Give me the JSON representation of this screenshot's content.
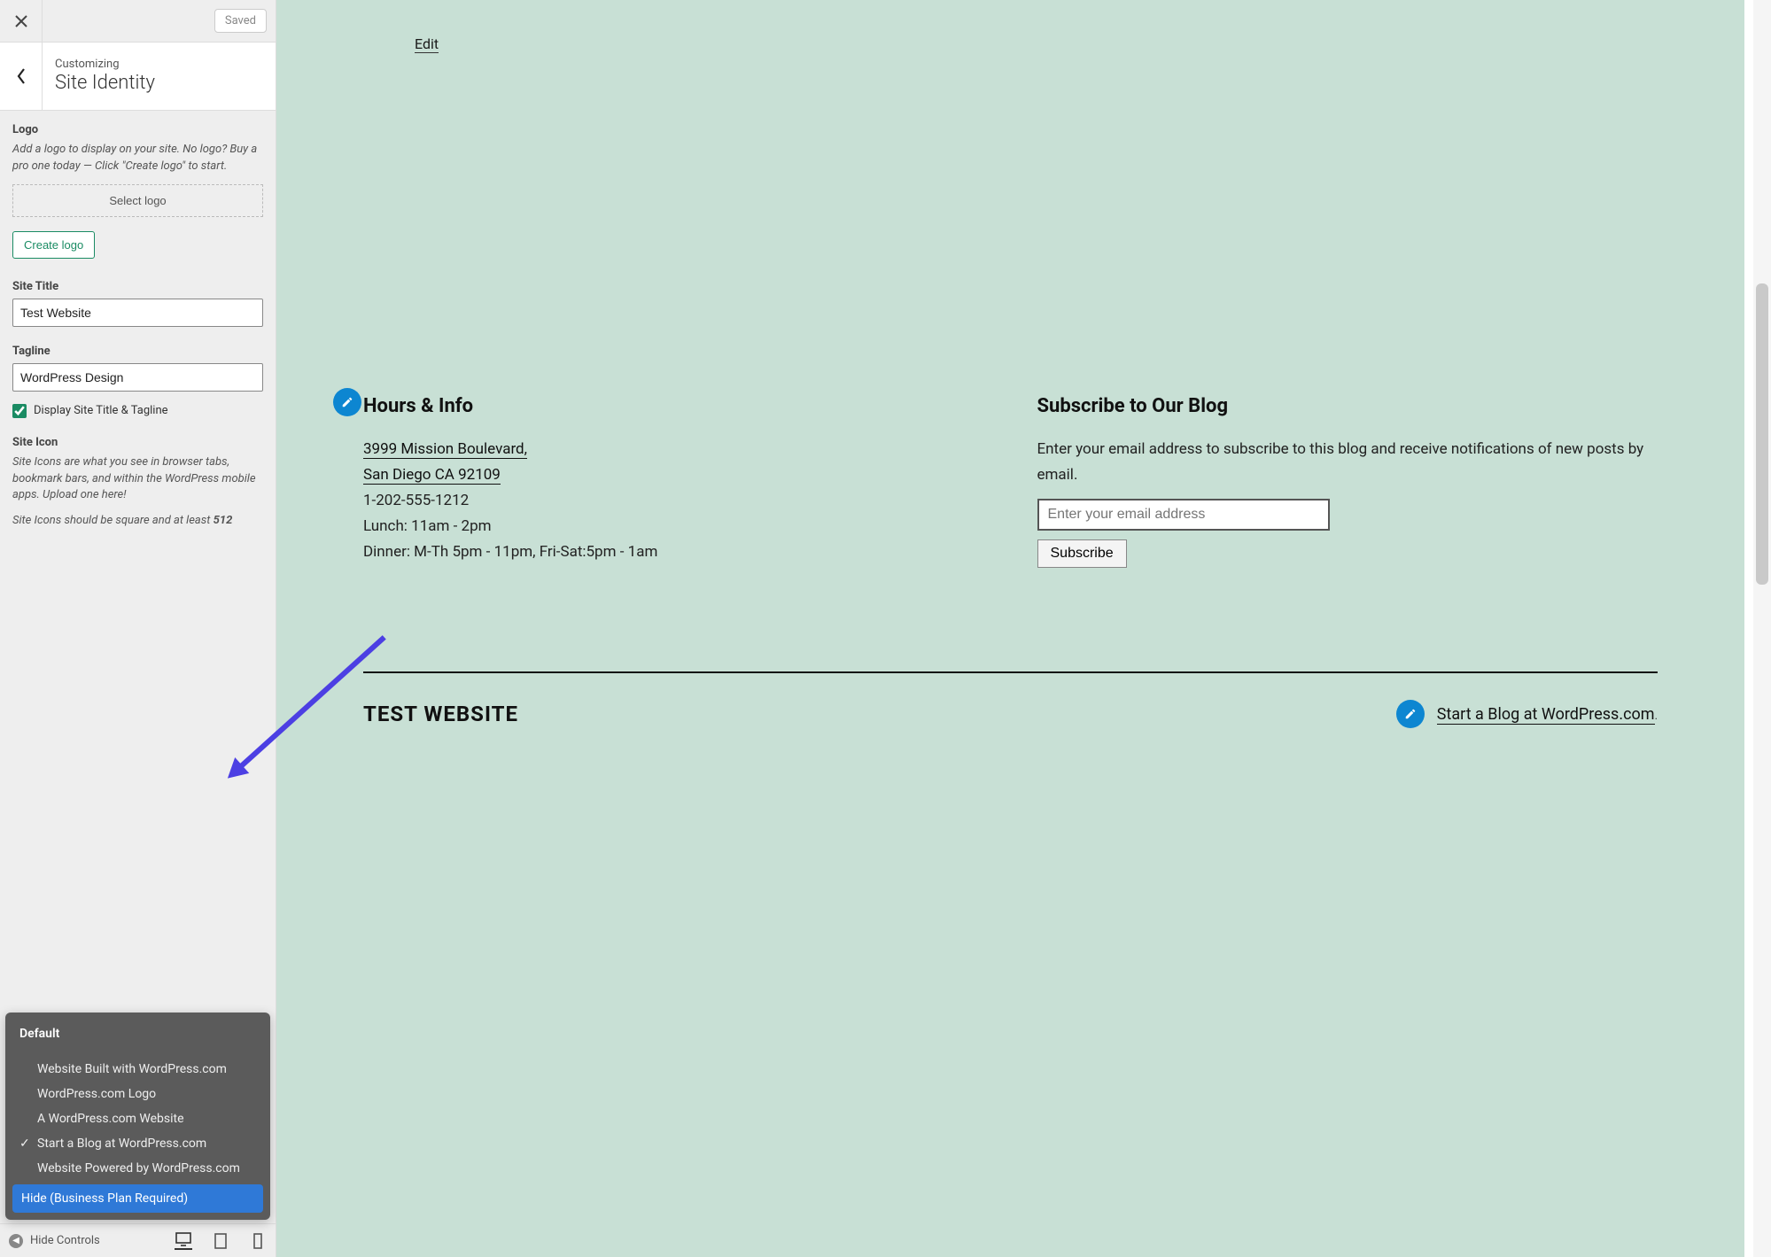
{
  "sidebar": {
    "saved_label": "Saved",
    "crumb_label": "Customizing",
    "crumb_title": "Site Identity",
    "logo": {
      "heading": "Logo",
      "help": "Add a logo to display on your site. No logo? Buy a pro one today — Click \"Create logo\" to start.",
      "select_label": "Select logo",
      "create_label": "Create logo"
    },
    "site_title": {
      "label": "Site Title",
      "value": "Test Website"
    },
    "tagline": {
      "label": "Tagline",
      "value": "WordPress Design"
    },
    "display_checkbox_label": "Display Site Title & Tagline",
    "site_icon": {
      "heading": "Site Icon",
      "help1": "Site Icons are what you see in browser tabs, bookmark bars, and within the WordPress mobile apps. Upload one here!",
      "help2_prefix": "Site Icons should be square and at least ",
      "help2_bold": "512"
    },
    "footer_dropdown": {
      "header": "Default",
      "items": [
        "Website Built with WordPress.com",
        "WordPress.com Logo",
        "A WordPress.com Website",
        "Start a Blog at WordPress.com",
        "Website Powered by WordPress.com"
      ],
      "selected_index": 3,
      "highlight": "Hide (Business Plan Required)"
    },
    "hide_controls_label": "Hide Controls"
  },
  "preview": {
    "edit_label": "Edit",
    "hours": {
      "heading": "Hours & Info",
      "addr1": "3999 Mission Boulevard,",
      "addr2": "San Diego CA 92109",
      "phone": "1-202-555-1212",
      "lunch": "Lunch: 11am - 2pm",
      "dinner": "Dinner: M-Th 5pm - 11pm, Fri-Sat:5pm - 1am"
    },
    "subscribe": {
      "heading": "Subscribe to Our Blog",
      "desc": "Enter your email address to subscribe to this blog and receive notifications of new posts by email.",
      "placeholder": "Enter your email address",
      "button": "Subscribe"
    },
    "footer": {
      "title": "TEST WEBSITE",
      "credit": "Start a Blog at WordPress.com",
      "credit_suffix": "."
    }
  }
}
